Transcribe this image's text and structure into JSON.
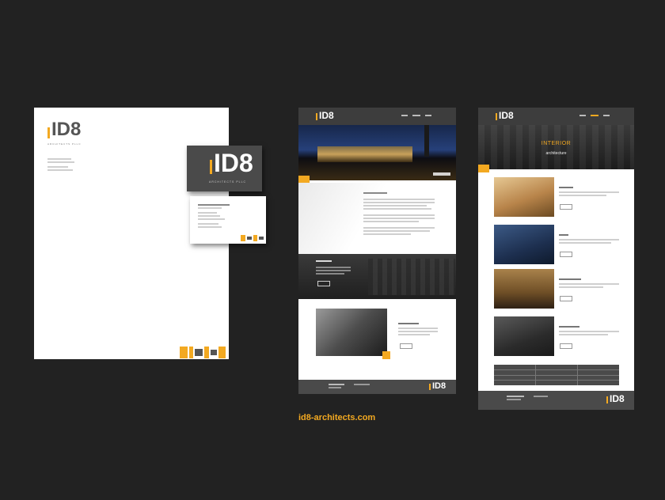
{
  "logo_text": "ID8",
  "letterhead": {
    "logo_sub": "ARCHITECTS PLLC"
  },
  "business_card": {
    "logo_sub": "ARCHITECTS PLLC"
  },
  "site_url": "id8-architects.com",
  "colors": {
    "background": "#222222",
    "accent": "#f3a921",
    "dark_gray": "#4a4a4a",
    "paper": "#ffffff"
  },
  "home_page": {
    "hero_caption": "",
    "about_heading": "",
    "project_heading": ""
  },
  "interior_page": {
    "hero_title": "INTERIOR",
    "hero_subtitle": "architecture"
  }
}
